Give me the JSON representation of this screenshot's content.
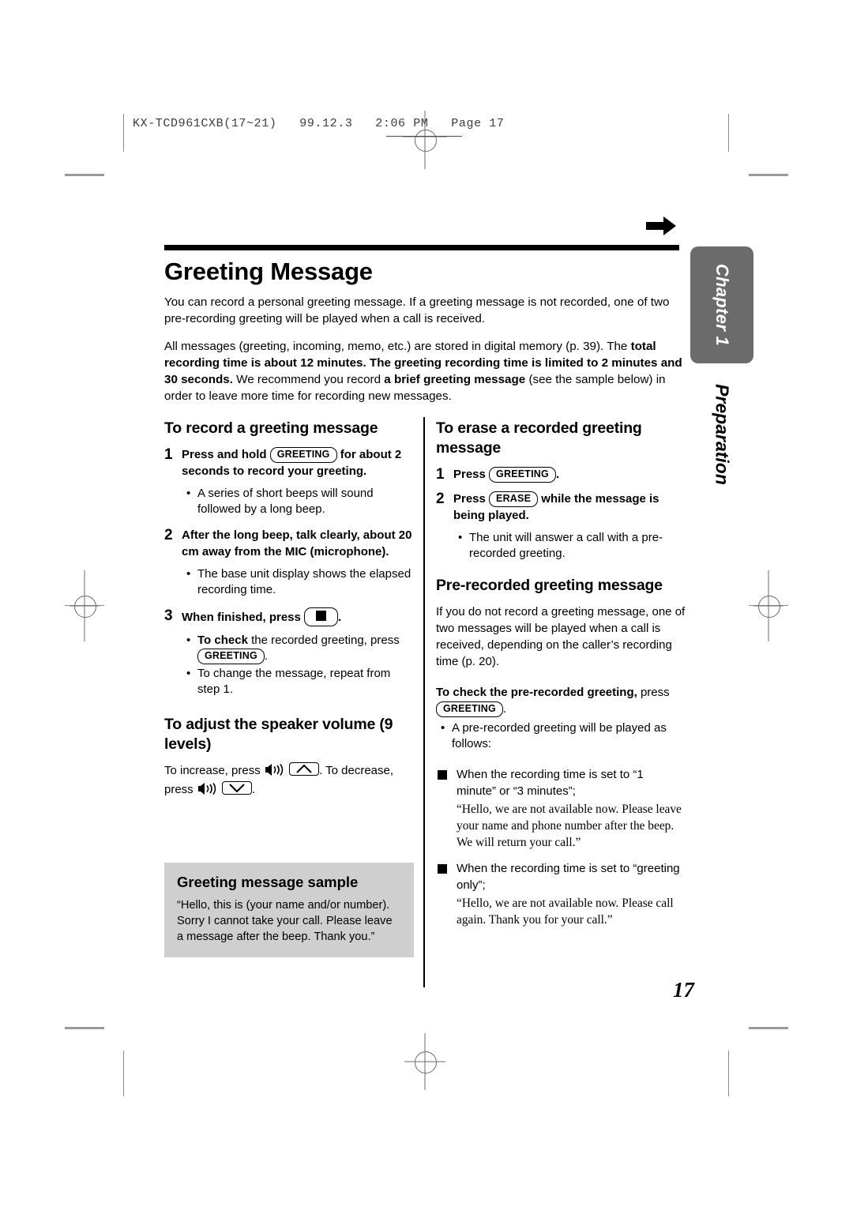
{
  "print_marks": {
    "slug": "KX-TCD961CXB(17~21)   99.12.3   2:06 PM   Page 17"
  },
  "chapter_tab": {
    "label": "Chapter 1",
    "subtitle": "Preparation",
    "color": "#6b6b6b"
  },
  "page": {
    "title": "Greeting Message",
    "folio": "17",
    "arrow_icon": "right-arrow-icon"
  },
  "intro": {
    "paragraph1": "You can record a personal greeting message. If a greeting message is not recorded, one of two pre-recording greeting will be played when a call is received.",
    "paragraph2": {
      "part1": "All messages (greeting, incoming, memo, etc.) are stored in digital memory (p. 39). The ",
      "bold1": "total recording time is about 12 minutes. The greeting recording time is limited to 2 minutes and 30 seconds.",
      "part2": " We recommend you record ",
      "bold2": "a brief greeting message",
      "part3": " (see the sample below) in order to leave more time for recording new messages."
    }
  },
  "left_column": {
    "record_section": {
      "heading": "To record a greeting message",
      "step1": {
        "num": "1",
        "text_before": "Press and hold",
        "key": "GREETING",
        "text_after": "for about 2 seconds to record your greeting.",
        "bullets": [
          "A series of short beeps will sound followed by a long beep."
        ]
      },
      "step2": {
        "num": "2",
        "text": "After the long beep, talk clearly, about 20 cm away from the MIC (microphone).",
        "bullets": [
          "The base unit display shows the elapsed recording time."
        ]
      },
      "step3": {
        "num": "3",
        "text_before": "When finished, press",
        "key": "stop-button-icon",
        "text_after": ".",
        "bullet1_bold": "To check",
        "bullet1_rest": " the recorded greeting, press",
        "bullet1_key": "GREETING",
        "bullet1_end": ".",
        "bullet2": "To change the message, repeat from step 1."
      }
    },
    "volume_section": {
      "heading": "To adjust the speaker volume (9 levels)",
      "text_increase": "To increase, press",
      "speaker_icon": "speaker-icon",
      "up_key": "up-arrow-key",
      "text_middle": ". To decrease, press",
      "down_key": "down-arrow-key",
      "text_end": "."
    },
    "sample_box": {
      "heading": "Greeting message sample",
      "text": "“Hello, this is (your name and/or number). Sorry I cannot take your call. Please leave a message after the beep. Thank you.”"
    }
  },
  "right_column": {
    "erase_section": {
      "heading": "To erase a recorded greeting message",
      "step1": {
        "num": "1",
        "text_before": "Press",
        "key": "GREETING",
        "text_after": "."
      },
      "step2": {
        "num": "2",
        "text_before": "Press",
        "key": "ERASE",
        "text_after": "while the message is being played.",
        "bullets": [
          "The unit will answer a call with a pre-recorded greeting."
        ]
      }
    },
    "prerecorded_section": {
      "heading": "Pre-recorded greeting message",
      "paragraph": "If you do not record a greeting message, one of two messages will be played when a call is received, depending on the caller’s recording time (p. 20).",
      "check_bold": "To check the pre-recorded greeting,",
      "check_rest": " press",
      "check_key": "GREETING",
      "check_end": ".",
      "bullet": "A pre-recorded greeting will be played as follows:",
      "case1_label": "When the recording time is set to “1 minute” or “3 minutes”;",
      "case1_quote": "“Hello, we are not available now. Please leave your name and phone number after the beep. We will return your call.”",
      "case2_label": "When the recording time is set to “greeting only”;",
      "case2_quote": "“Hello, we are not available now. Please call again. Thank you for your call.”"
    }
  }
}
